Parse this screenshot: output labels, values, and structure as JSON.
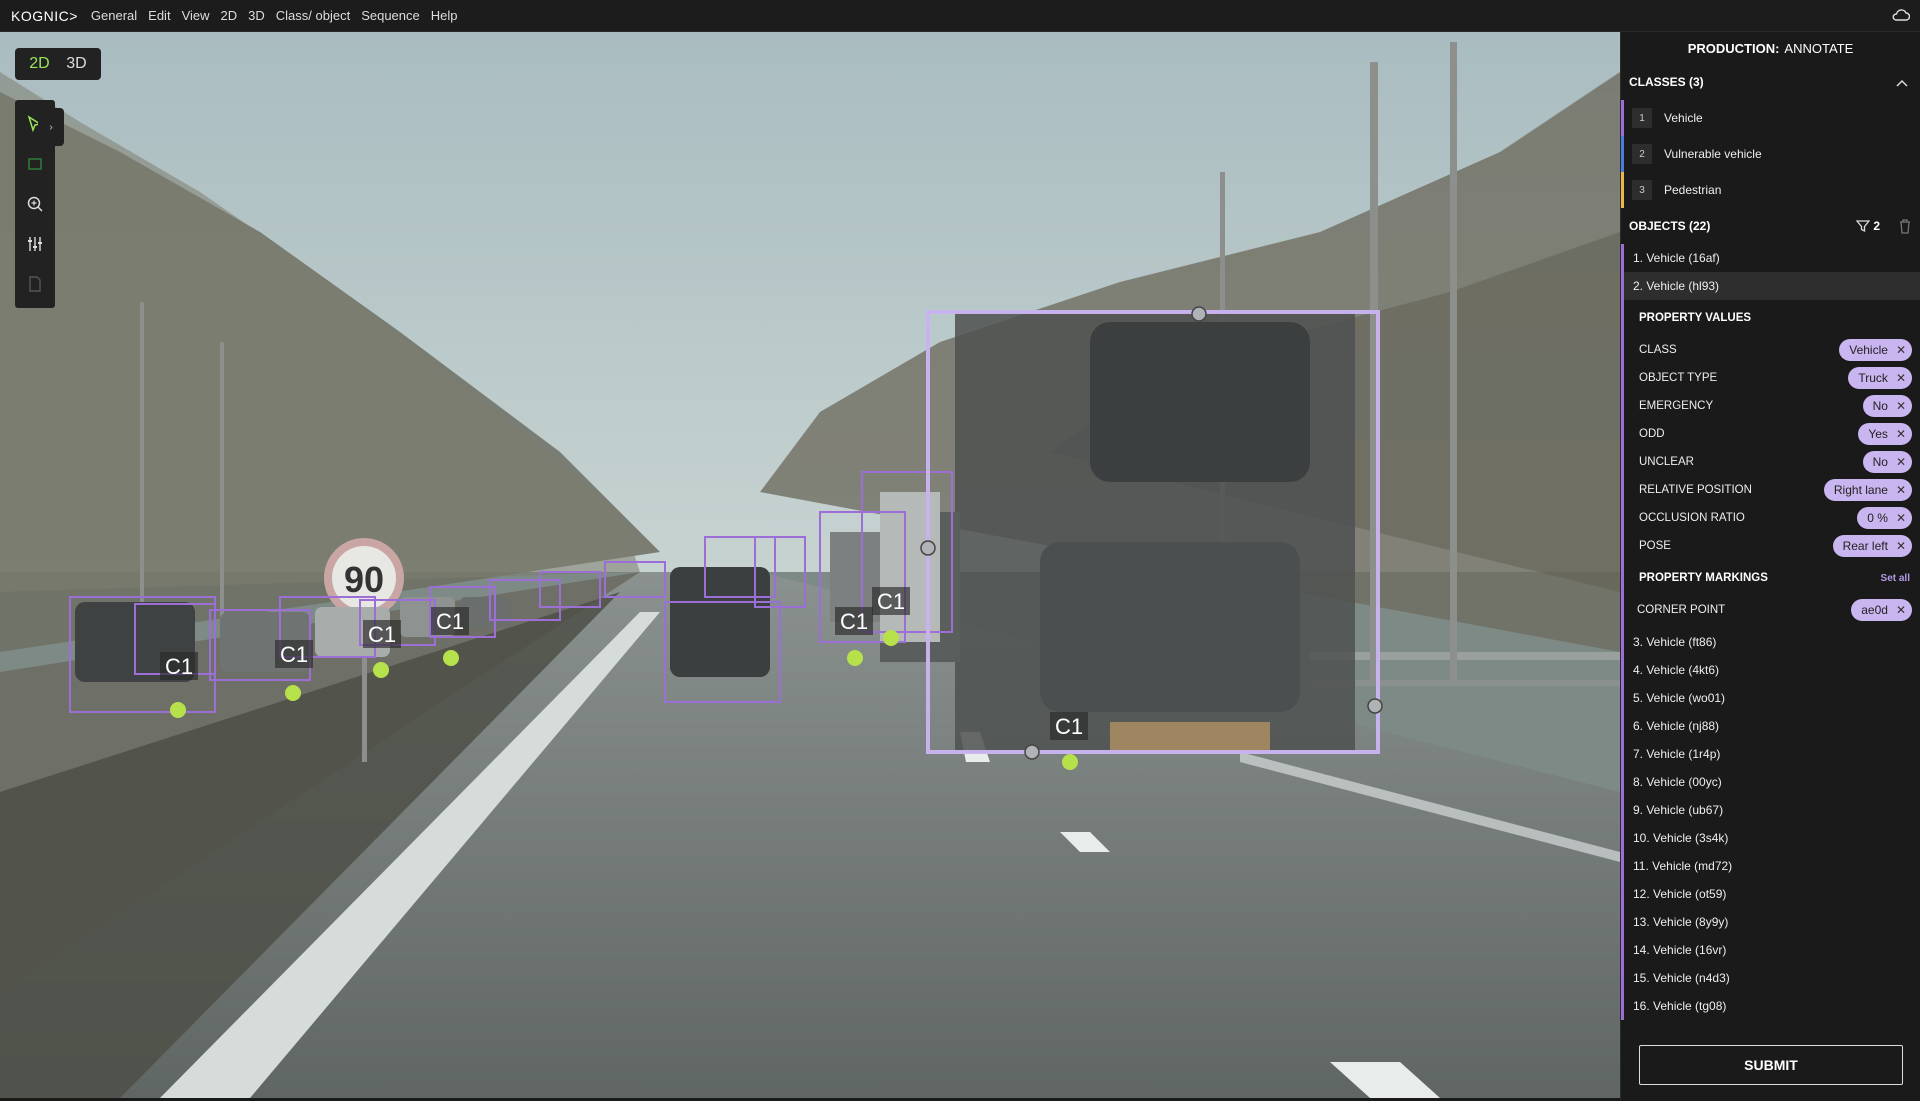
{
  "topbar": {
    "logo": "KOGNIC>",
    "menu": [
      "General",
      "Edit",
      "View",
      "2D",
      "3D",
      "Class/ object",
      "Sequence",
      "Help"
    ],
    "cloud_icon": "cloud-icon"
  },
  "view_toggle": {
    "options": [
      "2D",
      "3D"
    ],
    "active": "2D"
  },
  "tools": [
    "select-arrow-icon",
    "box-tool-icon",
    "zoom-search-icon",
    "sliders-settings-icon",
    "document-icon"
  ],
  "scene": {
    "sign_text": "90",
    "box_label": "C1",
    "annotation_color": "#9b6fd6",
    "point_color": "#b7e14a"
  },
  "panel": {
    "header_bold": "PRODUCTION:",
    "header_rest": "ANNOTATE",
    "classes_title": "CLASSES (3)",
    "classes": [
      {
        "num": "1",
        "label": "Vehicle",
        "color": "#9b6fd6"
      },
      {
        "num": "2",
        "label": "Vulnerable vehicle",
        "color": "#4a7be0"
      },
      {
        "num": "3",
        "label": "Pedestrian",
        "color": "#e8b84a"
      }
    ],
    "objects_title": "OBJECTS (22)",
    "filter_count": "2",
    "objects_before": [
      "1. Vehicle (16af)",
      "2. Vehicle (hl93)"
    ],
    "property_values_title": "PROPERTY VALUES",
    "properties": [
      {
        "name": "CLASS",
        "value": "Vehicle"
      },
      {
        "name": "OBJECT TYPE",
        "value": "Truck"
      },
      {
        "name": "EMERGENCY",
        "value": "No"
      },
      {
        "name": "ODD",
        "value": "Yes"
      },
      {
        "name": "UNCLEAR",
        "value": "No"
      },
      {
        "name": "RELATIVE POSITION",
        "value": "Right lane"
      },
      {
        "name": "OCCLUSION RATIO",
        "value": "0 %"
      },
      {
        "name": "POSE",
        "value": "Rear left"
      }
    ],
    "property_markings_title": "PROPERTY MARKINGS",
    "set_all": "Set all",
    "corner_point_label": "CORNER POINT",
    "corner_point_value": "ae0d",
    "objects_after": [
      "3. Vehicle (ft86)",
      "4. Vehicle (4kt6)",
      "5. Vehicle (wo01)",
      "6. Vehicle (nj88)",
      "7. Vehicle (1r4p)",
      "8. Vehicle (00yc)",
      "9. Vehicle (ub67)",
      "10. Vehicle (3s4k)",
      "11. Vehicle (md72)",
      "12. Vehicle (ot59)",
      "13. Vehicle (8y9y)",
      "14. Vehicle (16vr)",
      "15. Vehicle (n4d3)",
      "16. Vehicle (tg08)"
    ],
    "submit": "SUBMIT"
  }
}
